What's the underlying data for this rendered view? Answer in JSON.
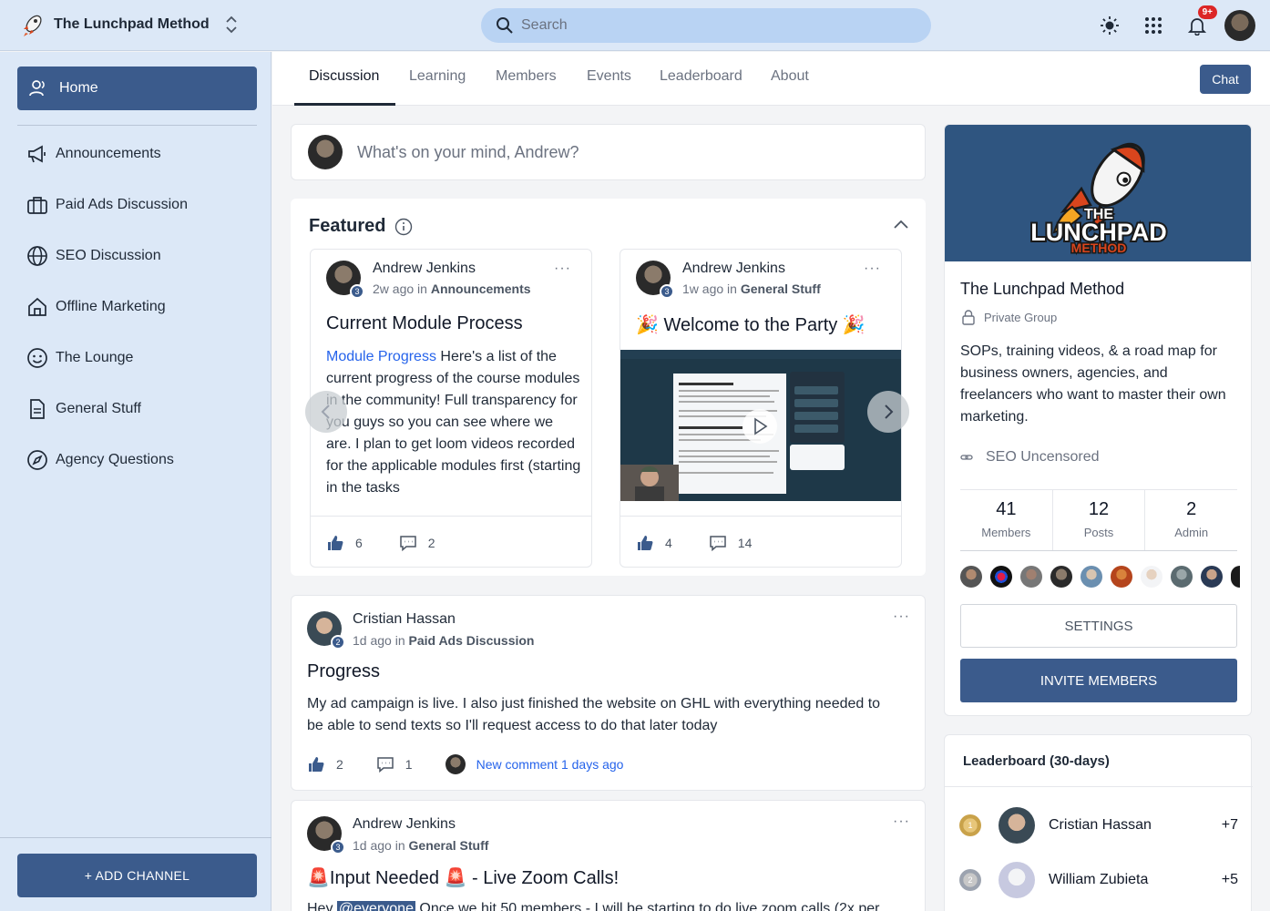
{
  "topbar": {
    "brand_name": "The Lunchpad Method",
    "search_placeholder": "Search",
    "notifications_badge": "9+"
  },
  "sidebar": {
    "home_label": "Home",
    "items": [
      {
        "label": "Announcements",
        "icon": "megaphone-icon"
      },
      {
        "label": "Paid Ads Discussion",
        "icon": "briefcase-icon"
      },
      {
        "label": "SEO Discussion",
        "icon": "globe-icon"
      },
      {
        "label": "Offline Marketing",
        "icon": "house-icon"
      },
      {
        "label": "The Lounge",
        "icon": "smile-icon"
      },
      {
        "label": "General Stuff",
        "icon": "document-icon"
      },
      {
        "label": "Agency Questions",
        "icon": "compass-icon"
      }
    ],
    "add_channel_label": "+ ADD CHANNEL"
  },
  "tabs": {
    "items": [
      "Discussion",
      "Learning",
      "Members",
      "Events",
      "Leaderboard",
      "About"
    ],
    "active": "Discussion",
    "chat_label": "Chat"
  },
  "composer": {
    "placeholder": "What's on your mind, Andrew?"
  },
  "featured": {
    "title": "Featured",
    "posts": [
      {
        "author": "Andrew Jenkins",
        "level": "3",
        "time": "2w ago",
        "in_word": "in",
        "channel": "Announcements",
        "title": "Current Module Process",
        "link_text": "Module Progress",
        "body": " Here's a list of the current progress of the course modules in the community! Full transparency for you guys so you can see where we are. I plan to get loom videos recorded for the applicable modules first (starting in the tasks",
        "likes": "6",
        "comments": "2"
      },
      {
        "author": "Andrew Jenkins",
        "level": "3",
        "time": "1w ago",
        "in_word": "in",
        "channel": "General Stuff",
        "title": "🎉 Welcome to the Party 🎉",
        "likes": "4",
        "comments": "14"
      }
    ]
  },
  "posts": [
    {
      "author": "Cristian Hassan",
      "level": "2",
      "time": "1d ago",
      "in_word": "in",
      "channel": "Paid Ads Discussion",
      "title": "Progress",
      "body": "My ad campaign is live. I also just finished the website on GHL with everything needed to be able to send texts so I'll request access to do that later today",
      "likes": "2",
      "comments": "1",
      "new_comment": "New comment 1 days ago"
    },
    {
      "author": "Andrew Jenkins",
      "level": "3",
      "time": "1d ago",
      "in_word": "in",
      "channel": "General Stuff",
      "title": "🚨Input Needed 🚨 - Live Zoom Calls!",
      "body_prefix": "Hey ",
      "mention": "@everyone",
      "body_suffix": " Once we hit 50 members - I will be starting to do live zoom calls (2x per"
    }
  ],
  "group": {
    "logo_line1": "THE",
    "logo_line2": "LUNCHPAD",
    "logo_line3": "METHOD",
    "name": "The Lunchpad Method",
    "privacy": "Private Group",
    "description": "SOPs, training videos, & a road map for business owners, agencies, and freelancers who want to master their own marketing.",
    "link": "SEO Uncensored",
    "stats": [
      {
        "value": "41",
        "label": "Members"
      },
      {
        "value": "12",
        "label": "Posts"
      },
      {
        "value": "2",
        "label": "Admin"
      }
    ],
    "settings_label": "SETTINGS",
    "invite_label": "INVITE MEMBERS"
  },
  "leaderboard": {
    "title": "Leaderboard (30-days)",
    "rows": [
      {
        "rank": "1",
        "name": "Cristian Hassan",
        "points": "+7"
      },
      {
        "rank": "2",
        "name": "William Zubieta",
        "points": "+5"
      }
    ]
  }
}
